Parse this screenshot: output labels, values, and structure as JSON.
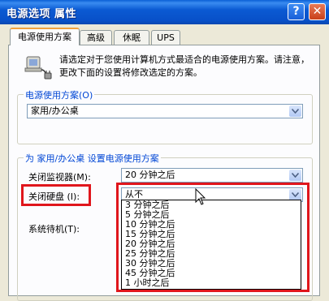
{
  "window": {
    "title": "电源选项 属性",
    "help": "?",
    "close": "✕"
  },
  "tabs": [
    {
      "label": "电源使用方案"
    },
    {
      "label": "高级"
    },
    {
      "label": "休眠"
    },
    {
      "label": "UPS"
    }
  ],
  "intro_text": "请选定对于您使用计算机方式最适合的电源使用方案。请注意，更改下面的设置将修改选定的方案。",
  "scheme_group": {
    "label": "电源使用方案(O)",
    "selected": "家用/办公桌"
  },
  "settings_group": {
    "label": "为 家用/办公桌 设置电源使用方案",
    "monitor_label": "关闭监视器(M):",
    "monitor_value": "20 分钟之后",
    "disk_label": "关闭硬盘 (I):",
    "disk_value": "从不",
    "standby_label": "系统待机(T):",
    "dropdown_options": [
      "3 分钟之后",
      "5 分钟之后",
      "10 分钟之后",
      "15 分钟之后",
      "20 分钟之后",
      "25 分钟之后",
      "30 分钟之后",
      "45 分钟之后",
      "1 小时之后"
    ]
  },
  "colors": {
    "title_bar": "#0b5ad3",
    "highlight_border": "#e0161c",
    "group_label": "#0046d5",
    "active_tab_accent": "#f2a13d"
  }
}
